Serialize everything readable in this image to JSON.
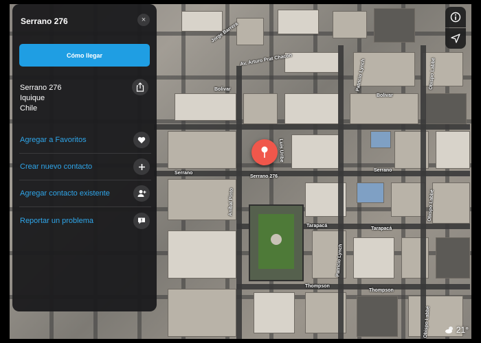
{
  "panel": {
    "title": "Serrano 276",
    "close_label": "×",
    "directions_label": "Cómo llegar",
    "address_lines": [
      "Serrano 276",
      "Iquique",
      "Chile"
    ],
    "actions": [
      {
        "label": "Agregar a Favoritos",
        "icon": "heart-icon"
      },
      {
        "label": "Crear nuevo contacto",
        "icon": "plus-icon"
      },
      {
        "label": "Agregar contacto existente",
        "icon": "add-person-icon"
      },
      {
        "label": "Reportar un problema",
        "icon": "speech-bubble-icon"
      }
    ]
  },
  "map": {
    "streets": [
      "Jorge Barrera",
      "Av. Arturo Prat Chacón",
      "Bolivar",
      "Bolivar",
      "Patricio Lynch",
      "Obispo Labbé",
      "Serrano",
      "Serrano 276",
      "Serrano",
      "Aníbal Pinto",
      "Luis Uribe",
      "Tarapacá",
      "Tarapacá",
      "Patricio Lynch",
      "Obispo Labbé",
      "Thompson",
      "Thompson",
      "Obispo Labbé"
    ],
    "pin_color": "#f0574b"
  },
  "weather": {
    "temperature": "21°",
    "icon": "cloud-sun-icon"
  },
  "controls": {
    "info_icon": "info-icon",
    "location_icon": "location-arrow-icon"
  }
}
